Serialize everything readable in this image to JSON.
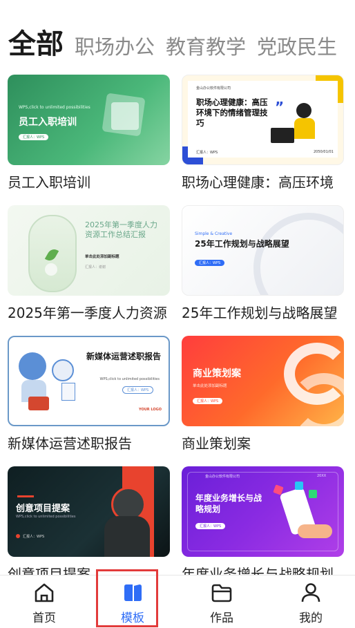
{
  "tabs": [
    "全部",
    "职场办公",
    "教育教学",
    "党政民生"
  ],
  "templates": [
    {
      "caption": "员工入职培训",
      "thumb_title": "员工入职培训",
      "thumb_sub": "WPS,click to unlimited possibilities",
      "thumb_pill": "汇报人：WPS"
    },
    {
      "caption": "职场心理健康：高压环境",
      "thumb_title": "职场心理健康：高压环境下的情绪管理技巧",
      "thumb_sub": "金山办公软件有限公司",
      "thumb_pill": "汇报人：WPS",
      "thumb_date": "2050/01/01"
    },
    {
      "caption": "2025年第一季度人力资源",
      "thumb_title": "2025年第一季度人力资源工作总结汇报",
      "thumb_sub": "单击此处添加副标题",
      "thumb_pill": "汇报人：谢谢"
    },
    {
      "caption": "25年工作规划与战略展望",
      "thumb_title": "25年工作规划与战略展望",
      "thumb_sub": "Simple & Creative",
      "thumb_pill": "汇报人：WPS"
    },
    {
      "caption": "新媒体运营述职报告",
      "thumb_title": "新媒体运营述职报告",
      "thumb_sub": "WPS,click to unlimited possibilities",
      "thumb_pill": "汇报人：WPS",
      "thumb_logo": "YOUR LOGO"
    },
    {
      "caption": "商业策划案",
      "thumb_title": "商业策划案",
      "thumb_sub": "单击此处添加副标题",
      "thumb_pill": "汇报人：WPS"
    },
    {
      "caption": "创意项目提案",
      "thumb_title": "创意项目提案",
      "thumb_sub": "WPS,click to unlimited possibilities",
      "thumb_pill": "汇报人：WPS"
    },
    {
      "caption": "年度业务增长与战略规划",
      "thumb_title": "年度业务增长与战略规划",
      "thumb_sub": "金山办公软件有限公司",
      "thumb_pill": "汇报人：WPS",
      "thumb_date": "20XX"
    }
  ],
  "nav": [
    {
      "label": "首页",
      "icon": "home-icon"
    },
    {
      "label": "模板",
      "icon": "template-icon"
    },
    {
      "label": "作品",
      "icon": "folder-icon"
    },
    {
      "label": "我的",
      "icon": "user-icon"
    }
  ],
  "colors": {
    "accent": "#2f6df6",
    "highlight": "#e23b3b"
  }
}
